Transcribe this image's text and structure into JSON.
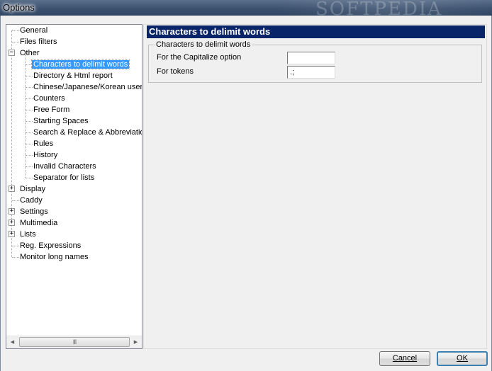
{
  "window": {
    "title": "Options",
    "watermark": "SOFTPEDIA"
  },
  "tree": {
    "items": [
      {
        "label": "General"
      },
      {
        "label": "Files filters"
      },
      {
        "label": "Other",
        "expander": "−"
      },
      {
        "label": "Characters to delimit words",
        "selected": true
      },
      {
        "label": "Directory & Html report"
      },
      {
        "label": "Chinese/Japanese/Korean users"
      },
      {
        "label": "Counters"
      },
      {
        "label": "Free Form"
      },
      {
        "label": "Starting Spaces"
      },
      {
        "label": "Search & Replace & Abbreviations"
      },
      {
        "label": "Rules"
      },
      {
        "label": "History"
      },
      {
        "label": "Invalid Characters"
      },
      {
        "label": "Separator for lists"
      },
      {
        "label": "Display",
        "expander": "+"
      },
      {
        "label": "Caddy"
      },
      {
        "label": "Settings",
        "expander": "+"
      },
      {
        "label": "Multimedia",
        "expander": "+"
      },
      {
        "label": "Lists",
        "expander": "+"
      },
      {
        "label": "Reg. Expressions"
      },
      {
        "label": "Monitor long names"
      }
    ],
    "scroll": {
      "left_arrow": "◀",
      "right_arrow": "▶",
      "grip": "III"
    }
  },
  "panel": {
    "header": "Characters to delimit words",
    "group_title": "Characters to delimit words",
    "fields": [
      {
        "label": "For the Capitalize option",
        "value": ""
      },
      {
        "label": "For tokens",
        "value": ".;"
      }
    ]
  },
  "buttons": {
    "cancel": "Cancel",
    "ok": "OK"
  }
}
